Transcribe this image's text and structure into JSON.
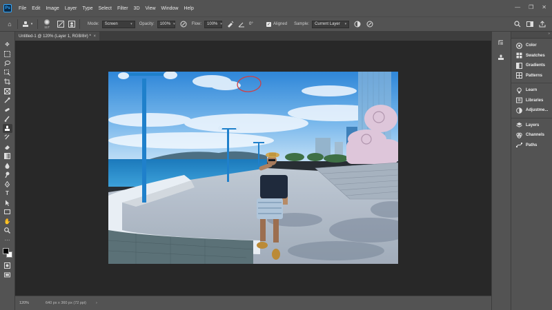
{
  "menu": [
    "File",
    "Edit",
    "Image",
    "Layer",
    "Type",
    "Select",
    "Filter",
    "3D",
    "View",
    "Window",
    "Help"
  ],
  "options": {
    "brush_size": "117",
    "mode_label": "Mode:",
    "mode_value": "Screen",
    "opacity_label": "Opacity:",
    "opacity_value": "100%",
    "flow_label": "Flow:",
    "flow_value": "100%",
    "angle_value": "0°",
    "aligned_label": "Aligned",
    "sample_label": "Sample:",
    "sample_value": "Current Layer"
  },
  "document": {
    "tab_title": "Untitled-1 @ 120% (Layer 1, RGB/8#) *",
    "close_glyph": "×"
  },
  "status": {
    "zoom": "120%",
    "doc_info": "640 px x 360 px (72 ppi)",
    "arrow": "›"
  },
  "panels": [
    [
      {
        "icon": "color-icon",
        "label": "Color"
      },
      {
        "icon": "swatches-icon",
        "label": "Swatches"
      },
      {
        "icon": "gradients-icon",
        "label": "Gradients"
      },
      {
        "icon": "patterns-icon",
        "label": "Patterns"
      }
    ],
    [
      {
        "icon": "learn-icon",
        "label": "Learn"
      },
      {
        "icon": "libraries-icon",
        "label": "Libraries"
      },
      {
        "icon": "adjustments-icon",
        "label": "Adjustme..."
      }
    ],
    [
      {
        "icon": "layers-icon",
        "label": "Layers"
      },
      {
        "icon": "channels-icon",
        "label": "Channels"
      },
      {
        "icon": "paths-icon",
        "label": "Paths"
      }
    ]
  ],
  "colors": {
    "accent": "#31a8ff",
    "ui_bg": "#535353",
    "canvas_bg": "#282828",
    "annotation_circle": "#d83a3a"
  }
}
